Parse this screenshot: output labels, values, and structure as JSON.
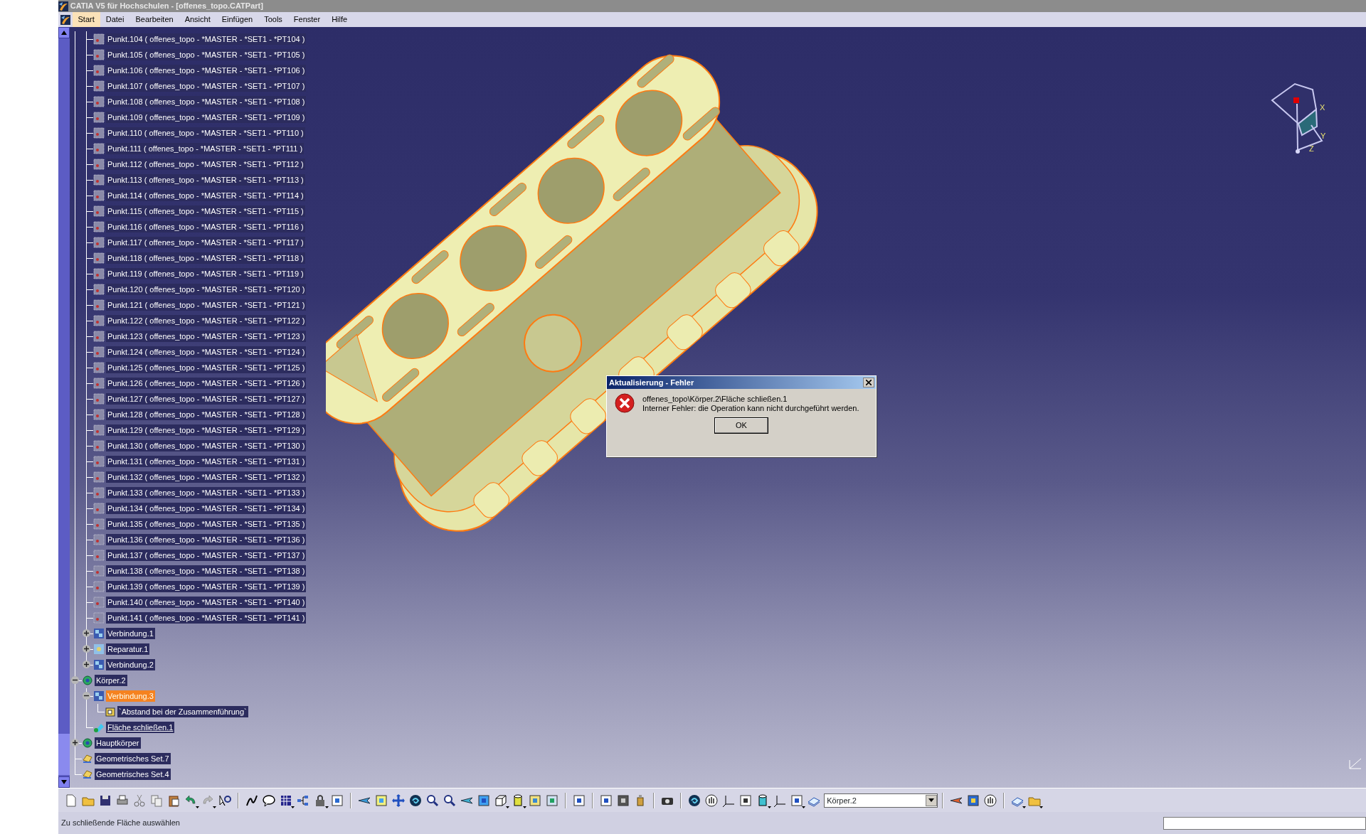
{
  "window": {
    "title": "CATIA V5 für Hochschulen - [offenes_topo.CATPart]"
  },
  "menu": [
    {
      "label": "Start",
      "selected": true
    },
    {
      "label": "Datei",
      "selected": false
    },
    {
      "label": "Bearbeiten",
      "selected": false
    },
    {
      "label": "Ansicht",
      "selected": false
    },
    {
      "label": "Einfügen",
      "selected": false
    },
    {
      "label": "Tools",
      "selected": false
    },
    {
      "label": "Fenster",
      "selected": false
    },
    {
      "label": "Hilfe",
      "selected": false
    }
  ],
  "tree": [
    {
      "children": [
        {
          "kind": "point",
          "label": "Punkt.104 ( offenes_topo - *MASTER - *SET1 - *PT104 )",
          "selected": false,
          "current": false
        },
        {
          "kind": "point",
          "label": "Punkt.105 ( offenes_topo - *MASTER - *SET1 - *PT105 )",
          "selected": false,
          "current": false
        },
        {
          "kind": "point",
          "label": "Punkt.106 ( offenes_topo - *MASTER - *SET1 - *PT106 )",
          "selected": false,
          "current": false
        },
        {
          "kind": "point",
          "label": "Punkt.107 ( offenes_topo - *MASTER - *SET1 - *PT107 )",
          "selected": false,
          "current": false
        },
        {
          "kind": "point",
          "label": "Punkt.108 ( offenes_topo - *MASTER - *SET1 - *PT108 )",
          "selected": false,
          "current": false
        },
        {
          "kind": "point",
          "label": "Punkt.109 ( offenes_topo - *MASTER - *SET1 - *PT109 )",
          "selected": false,
          "current": false
        },
        {
          "kind": "point",
          "label": "Punkt.110 ( offenes_topo - *MASTER - *SET1 - *PT110 )",
          "selected": false,
          "current": false
        },
        {
          "kind": "point",
          "label": "Punkt.111 ( offenes_topo - *MASTER - *SET1 - *PT111 )",
          "selected": false,
          "current": false
        },
        {
          "kind": "point",
          "label": "Punkt.112 ( offenes_topo - *MASTER - *SET1 - *PT112 )",
          "selected": false,
          "current": false
        },
        {
          "kind": "point",
          "label": "Punkt.113 ( offenes_topo - *MASTER - *SET1 - *PT113 )",
          "selected": false,
          "current": false
        },
        {
          "kind": "point",
          "label": "Punkt.114 ( offenes_topo - *MASTER - *SET1 - *PT114 )",
          "selected": false,
          "current": false
        },
        {
          "kind": "point",
          "label": "Punkt.115 ( offenes_topo - *MASTER - *SET1 - *PT115 )",
          "selected": false,
          "current": false
        },
        {
          "kind": "point",
          "label": "Punkt.116 ( offenes_topo - *MASTER - *SET1 - *PT116 )",
          "selected": false,
          "current": false
        },
        {
          "kind": "point",
          "label": "Punkt.117 ( offenes_topo - *MASTER - *SET1 - *PT117 )",
          "selected": false,
          "current": false
        },
        {
          "kind": "point",
          "label": "Punkt.118 ( offenes_topo - *MASTER - *SET1 - *PT118 )",
          "selected": false,
          "current": false
        },
        {
          "kind": "point",
          "label": "Punkt.119 ( offenes_topo - *MASTER - *SET1 - *PT119 )",
          "selected": false,
          "current": false
        },
        {
          "kind": "point",
          "label": "Punkt.120 ( offenes_topo - *MASTER - *SET1 - *PT120 )",
          "selected": false,
          "current": false
        },
        {
          "kind": "point",
          "label": "Punkt.121 ( offenes_topo - *MASTER - *SET1 - *PT121 )",
          "selected": false,
          "current": false
        },
        {
          "kind": "point",
          "label": "Punkt.122 ( offenes_topo - *MASTER - *SET1 - *PT122 )",
          "selected": false,
          "current": false
        },
        {
          "kind": "point",
          "label": "Punkt.123 ( offenes_topo - *MASTER - *SET1 - *PT123 )",
          "selected": false,
          "current": false
        },
        {
          "kind": "point",
          "label": "Punkt.124 ( offenes_topo - *MASTER - *SET1 - *PT124 )",
          "selected": false,
          "current": false
        },
        {
          "kind": "point",
          "label": "Punkt.125 ( offenes_topo - *MASTER - *SET1 - *PT125 )",
          "selected": false,
          "current": false
        },
        {
          "kind": "point",
          "label": "Punkt.126 ( offenes_topo - *MASTER - *SET1 - *PT126 )",
          "selected": false,
          "current": false
        },
        {
          "kind": "point",
          "label": "Punkt.127 ( offenes_topo - *MASTER - *SET1 - *PT127 )",
          "selected": false,
          "current": false
        },
        {
          "kind": "point",
          "label": "Punkt.128 ( offenes_topo - *MASTER - *SET1 - *PT128 )",
          "selected": false,
          "current": false
        },
        {
          "kind": "point",
          "label": "Punkt.129 ( offenes_topo - *MASTER - *SET1 - *PT129 )",
          "selected": false,
          "current": false
        },
        {
          "kind": "point",
          "label": "Punkt.130 ( offenes_topo - *MASTER - *SET1 - *PT130 )",
          "selected": false,
          "current": false
        },
        {
          "kind": "point",
          "label": "Punkt.131 ( offenes_topo - *MASTER - *SET1 - *PT131 )",
          "selected": false,
          "current": false
        },
        {
          "kind": "point",
          "label": "Punkt.132 ( offenes_topo - *MASTER - *SET1 - *PT132 )",
          "selected": false,
          "current": false
        },
        {
          "kind": "point",
          "label": "Punkt.133 ( offenes_topo - *MASTER - *SET1 - *PT133 )",
          "selected": false,
          "current": false
        },
        {
          "kind": "point",
          "label": "Punkt.134 ( offenes_topo - *MASTER - *SET1 - *PT134 )",
          "selected": false,
          "current": false
        },
        {
          "kind": "point",
          "label": "Punkt.135 ( offenes_topo - *MASTER - *SET1 - *PT135 )",
          "selected": false,
          "current": false
        },
        {
          "kind": "point",
          "label": "Punkt.136 ( offenes_topo - *MASTER - *SET1 - *PT136 )",
          "selected": false,
          "current": false
        },
        {
          "kind": "point",
          "label": "Punkt.137 ( offenes_topo - *MASTER - *SET1 - *PT137 )",
          "selected": false,
          "current": false
        },
        {
          "kind": "point",
          "label": "Punkt.138 ( offenes_topo - *MASTER - *SET1 - *PT138 )",
          "selected": false,
          "current": false
        },
        {
          "kind": "point",
          "label": "Punkt.139 ( offenes_topo - *MASTER - *SET1 - *PT139 )",
          "selected": false,
          "current": false
        },
        {
          "kind": "point",
          "label": "Punkt.140 ( offenes_topo - *MASTER - *SET1 - *PT140 )",
          "selected": false,
          "current": false
        },
        {
          "kind": "point",
          "label": "Punkt.141 ( offenes_topo - *MASTER - *SET1 - *PT141 )",
          "selected": false,
          "current": false
        },
        {
          "kind": "join",
          "label": "Verbindung.1",
          "expanded": false,
          "selected": false,
          "current": false
        },
        {
          "kind": "repair",
          "label": "Reparatur.1",
          "expanded": false,
          "selected": false,
          "current": false
        },
        {
          "kind": "join",
          "label": "Verbindung.2",
          "expanded": false,
          "selected": false,
          "current": false
        }
      ]
    },
    {
      "kind": "body",
      "label": "Körper.2",
      "expanded": true,
      "selected": false,
      "current": false,
      "children": [
        {
          "kind": "join",
          "label": "Verbindung.3",
          "expanded": true,
          "selected": true,
          "current": false,
          "children": [
            {
              "kind": "parameter",
              "label": "`Abstand bei der Zusammenführung`",
              "selected": false,
              "current": false
            }
          ]
        },
        {
          "kind": "close-surface",
          "label": "Fläche schließen.1",
          "selected": false,
          "current": true
        }
      ]
    },
    {
      "kind": "body",
      "label": "Hauptkörper",
      "expanded": false,
      "selected": false,
      "current": false
    },
    {
      "kind": "geoset",
      "label": "Geometrisches Set.7",
      "selected": false,
      "current": false
    },
    {
      "kind": "geoset",
      "label": "Geometrisches Set.4",
      "selected": false,
      "current": false
    }
  ],
  "compass": {
    "axes": [
      "X",
      "Y",
      "Z"
    ]
  },
  "dialog": {
    "title": "Aktualisierung - Fehler",
    "lines": [
      "offenes_topo\\Körper.2\\Fläche schließen.1",
      "Interner Fehler: die Operation kann nicht durchgeführt werden."
    ],
    "button": "OK"
  },
  "toolbar": {
    "body_combo": {
      "value": "Körper.2"
    }
  },
  "status_bar": {
    "message": "Zu schließende Fläche auswählen"
  }
}
